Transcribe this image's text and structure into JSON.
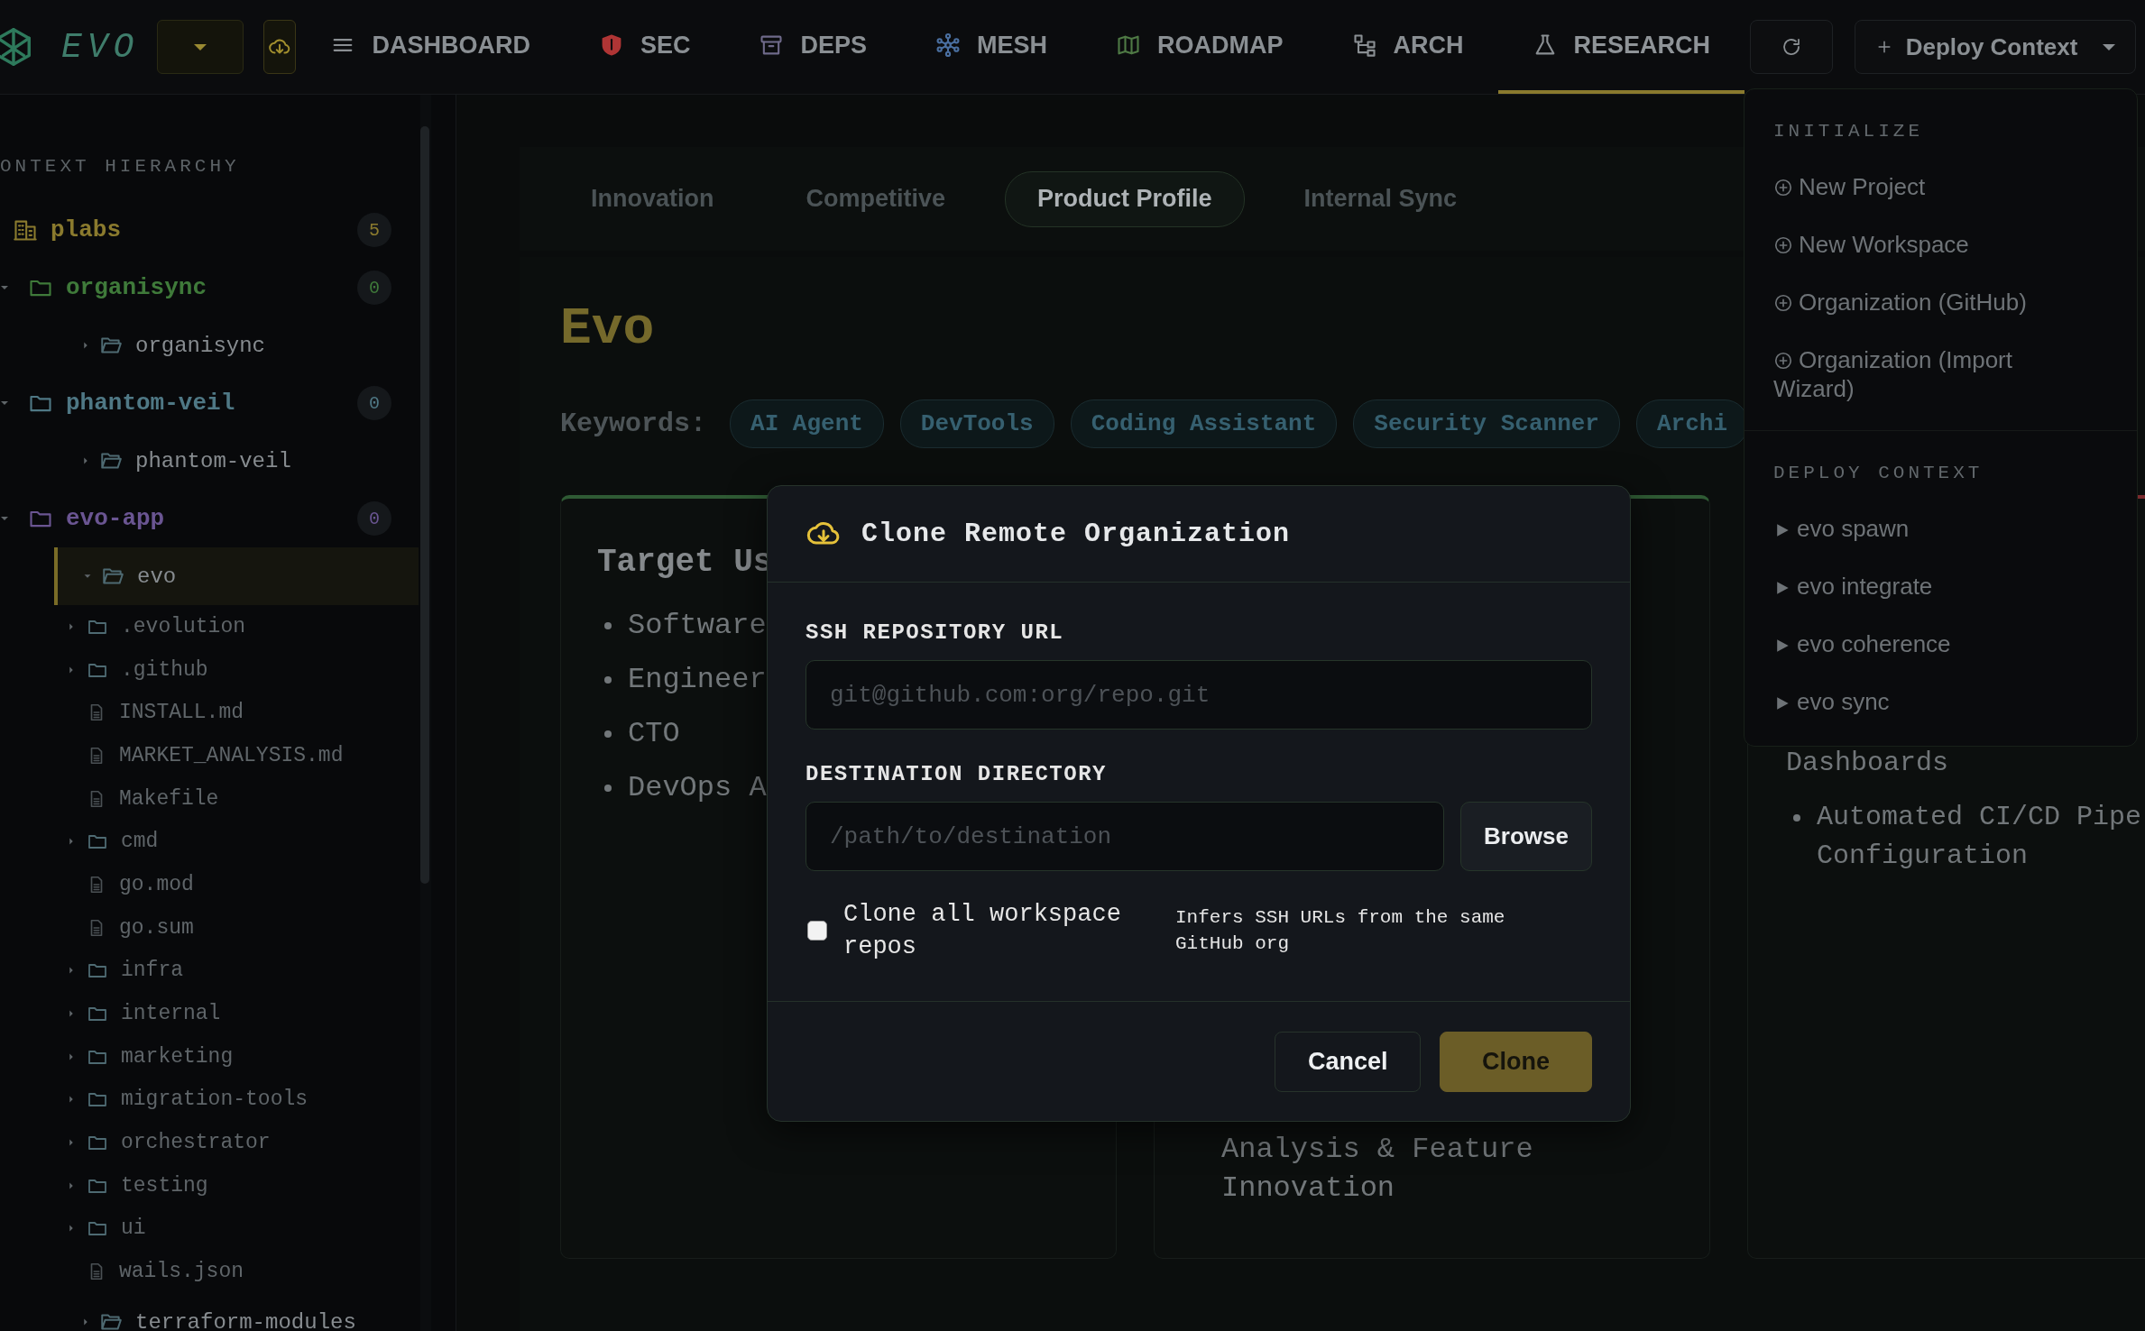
{
  "brand": {
    "name": "EVO"
  },
  "nav": [
    {
      "label": "DASHBOARD",
      "selected": false
    },
    {
      "label": "SEC",
      "selected": false
    },
    {
      "label": "DEPS",
      "selected": false
    },
    {
      "label": "MESH",
      "selected": false
    },
    {
      "label": "ROADMAP",
      "selected": false
    },
    {
      "label": "ARCH",
      "selected": false
    },
    {
      "label": "RESEARCH",
      "selected": true
    }
  ],
  "deploy_button": {
    "label": "Deploy Context"
  },
  "sidebar": {
    "title": "ONTEXT HIERARCHY",
    "tree": [
      {
        "label": "plabs",
        "kind": "org",
        "count": "5",
        "color": "#8a7a2e"
      },
      {
        "label": "organisync",
        "kind": "project",
        "count": "0",
        "color": "#3f7a3a",
        "expanded": true,
        "children": [
          {
            "label": "organisync",
            "kind": "folder",
            "expanded": false,
            "selected": false
          }
        ]
      },
      {
        "label": "phantom-veil",
        "kind": "project",
        "count": "0",
        "color": "#4f7885",
        "expanded": true,
        "children": [
          {
            "label": "phantom-veil",
            "kind": "folder",
            "expanded": false,
            "selected": false
          }
        ]
      },
      {
        "label": "evo-app",
        "kind": "project",
        "count": "0",
        "color": "#6a5592",
        "expanded": true,
        "children": [
          {
            "label": "evo",
            "kind": "folder",
            "expanded": true,
            "selected": true,
            "children": [
              {
                "label": ".evolution",
                "kind": "folder",
                "expanded": false
              },
              {
                "label": ".github",
                "kind": "folder",
                "expanded": false
              },
              {
                "label": "INSTALL.md",
                "kind": "file"
              },
              {
                "label": "MARKET_ANALYSIS.md",
                "kind": "file"
              },
              {
                "label": "Makefile",
                "kind": "file"
              },
              {
                "label": "cmd",
                "kind": "folder",
                "expanded": false
              },
              {
                "label": "go.mod",
                "kind": "file"
              },
              {
                "label": "go.sum",
                "kind": "file"
              },
              {
                "label": "infra",
                "kind": "folder",
                "expanded": false
              },
              {
                "label": "internal",
                "kind": "folder",
                "expanded": false
              },
              {
                "label": "marketing",
                "kind": "folder",
                "expanded": false
              },
              {
                "label": "migration-tools",
                "kind": "folder",
                "expanded": false
              },
              {
                "label": "orchestrator",
                "kind": "folder",
                "expanded": false
              },
              {
                "label": "testing",
                "kind": "folder",
                "expanded": false
              },
              {
                "label": "ui",
                "kind": "folder",
                "expanded": false
              },
              {
                "label": "wails.json",
                "kind": "file"
              }
            ]
          },
          {
            "label": "terraform-modules",
            "kind": "folder",
            "expanded": false,
            "selected": false
          }
        ]
      }
    ]
  },
  "tabs": [
    {
      "label": "Innovation",
      "selected": false
    },
    {
      "label": "Competitive",
      "selected": false
    },
    {
      "label": "Product Profile",
      "selected": true
    },
    {
      "label": "Internal Sync",
      "selected": false
    }
  ],
  "product": {
    "name": "Evo",
    "keywords_label": "Keywords:",
    "keywords": [
      "AI Agent",
      "DevTools",
      "Coding Assistant",
      "Security Scanner",
      "Archi"
    ]
  },
  "cards": [
    {
      "color": "#2f5a34",
      "title": "Target Us",
      "items": [
        {
          "kind": "bullet",
          "text": "Software"
        },
        {
          "kind": "bullet",
          "text": "Engineer"
        },
        {
          "kind": "bullet",
          "text": "CTO"
        },
        {
          "kind": "bullet",
          "text": "DevOps A"
        }
      ]
    },
    {
      "color": "#2f5a34",
      "items": [
        {
          "kind": "continuation",
          "text": "Analysis & Feature Innovation"
        }
      ]
    },
    {
      "color": "#7a2a2e",
      "items": [
        {
          "kind": "continuation",
          "text": "Dashboards"
        },
        {
          "kind": "bullet",
          "text": "Automated CI/CD Pipe Configuration"
        }
      ]
    }
  ],
  "menu": {
    "sections": [
      {
        "title": "INITIALIZE",
        "items": [
          {
            "label": "New Project",
            "kind": "add"
          },
          {
            "label": "New Workspace",
            "kind": "add"
          },
          {
            "label": "Organization (GitHub)",
            "kind": "add"
          },
          {
            "label": "Organization (Import Wizard)",
            "kind": "add"
          }
        ]
      },
      {
        "title": "DEPLOY CONTEXT",
        "items": [
          {
            "label": "evo spawn",
            "kind": "run"
          },
          {
            "label": "evo integrate",
            "kind": "run"
          },
          {
            "label": "evo coherence",
            "kind": "run"
          },
          {
            "label": "evo sync",
            "kind": "run"
          }
        ]
      }
    ]
  },
  "modal": {
    "title": "Clone Remote Organization",
    "fields": [
      {
        "label": "SSH REPOSITORY URL",
        "placeholder": "git@github.com:org/repo.git"
      },
      {
        "label": "DESTINATION DIRECTORY",
        "placeholder": "/path/to/destination",
        "button": "Browse"
      }
    ],
    "checkbox": {
      "label": "Clone all workspace repos",
      "checked": false,
      "hint": "Infers SSH URLs from the same GitHub org"
    },
    "buttons": [
      {
        "label": "Cancel",
        "kind": "secondary"
      },
      {
        "label": "Clone",
        "kind": "primary"
      }
    ]
  }
}
